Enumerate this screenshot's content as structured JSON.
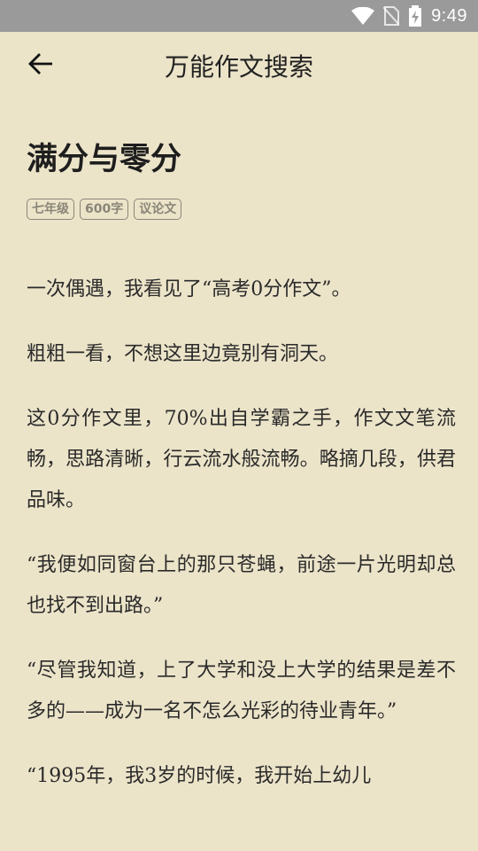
{
  "status_bar": {
    "time": "9:49",
    "icons": [
      "wifi-icon",
      "no-sim-icon",
      "battery-charging-icon"
    ]
  },
  "app_bar": {
    "back_icon": "arrow-left-icon",
    "title": "万能作文搜索"
  },
  "article": {
    "title": "满分与零分",
    "tags": [
      "七年级",
      "600字",
      "议论文"
    ],
    "paragraphs": [
      "一次偶遇，我看见了“高考0分作文”。",
      "粗粗一看，不想这里边竟别有洞天。",
      "这0分作文里，70%出自学霸之手，作文文笔流畅，思路清晰，行云流水般流畅。略摘几段，供君品味。",
      "“我便如同窗台上的那只苍蝇，前途一片光明却总也找不到出路。”",
      "“尽管我知道，上了大学和没上大学的结果是差不多的——成为一名不怎么光彩的待业青年。”",
      "“1995年，我3岁的时候，我开始上幼儿"
    ]
  }
}
